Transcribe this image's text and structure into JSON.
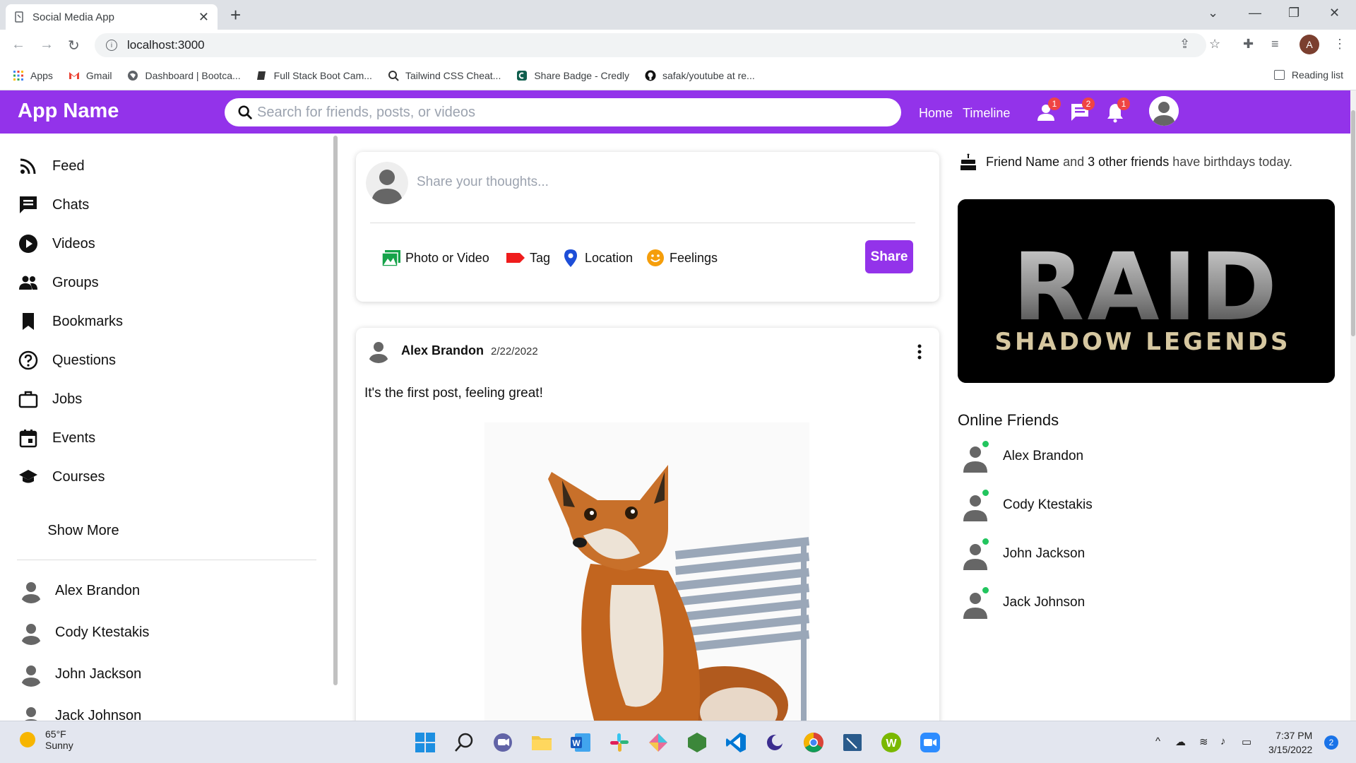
{
  "browser": {
    "tab_title": "Social Media App",
    "tab_close": "✕",
    "new_tab": "+",
    "url": "localhost:3000",
    "profile_initial": "A",
    "bookmarks": [
      {
        "label": "Apps",
        "icon": "apps-grid-icon"
      },
      {
        "label": "Gmail",
        "icon": "gmail-icon"
      },
      {
        "label": "Dashboard | Bootca...",
        "icon": "globe-icon"
      },
      {
        "label": "Full Stack Boot Cam...",
        "icon": "book-icon"
      },
      {
        "label": "Tailwind CSS Cheat...",
        "icon": "search-page-icon"
      },
      {
        "label": "Share Badge - Credly",
        "icon": "credly-icon"
      },
      {
        "label": "safak/youtube at re...",
        "icon": "github-icon"
      }
    ],
    "reading_list": "Reading list"
  },
  "header": {
    "logo": "App Name",
    "search_placeholder": "Search for friends, posts, or videos",
    "nav": {
      "home": "Home",
      "timeline": "Timeline"
    },
    "badges": {
      "friends": "1",
      "messages": "2",
      "notifications": "1"
    },
    "brand_color": "#9333ea"
  },
  "sidebar": {
    "items": [
      {
        "label": "Feed",
        "icon": "rss-feed-icon"
      },
      {
        "label": "Chats",
        "icon": "chat-icon"
      },
      {
        "label": "Videos",
        "icon": "play-circle-icon"
      },
      {
        "label": "Groups",
        "icon": "group-icon"
      },
      {
        "label": "Bookmarks",
        "icon": "bookmark-icon"
      },
      {
        "label": "Questions",
        "icon": "help-circle-icon"
      },
      {
        "label": "Jobs",
        "icon": "briefcase-icon"
      },
      {
        "label": "Events",
        "icon": "calendar-icon"
      },
      {
        "label": "Courses",
        "icon": "school-icon"
      }
    ],
    "show_more": "Show More",
    "friends": [
      "Alex Brandon",
      "Cody Ktestakis",
      "John Jackson",
      "Jack Johnson"
    ]
  },
  "share": {
    "placeholder": "Share your thoughts...",
    "options": {
      "photo": "Photo or Video",
      "tag": "Tag",
      "location": "Location",
      "feelings": "Feelings"
    },
    "button": "Share"
  },
  "post": {
    "author": "Alex Brandon",
    "date": "2/22/2022",
    "text": "It's the first post, feeling great!"
  },
  "rightbar": {
    "birthday": {
      "friend": "Friend Name",
      "and": "and",
      "others": "3 other friends",
      "rest": "have birthdays today."
    },
    "ad_line1": "RAID",
    "ad_line2": "SHADOW LEGENDS",
    "online_title": "Online Friends",
    "online": [
      "Alex Brandon",
      "Cody Ktestakis",
      "John Jackson",
      "Jack Johnson"
    ]
  },
  "taskbar": {
    "temp": "65°F",
    "condition": "Sunny",
    "time": "7:37 PM",
    "date": "3/15/2022",
    "notifications": "2"
  }
}
